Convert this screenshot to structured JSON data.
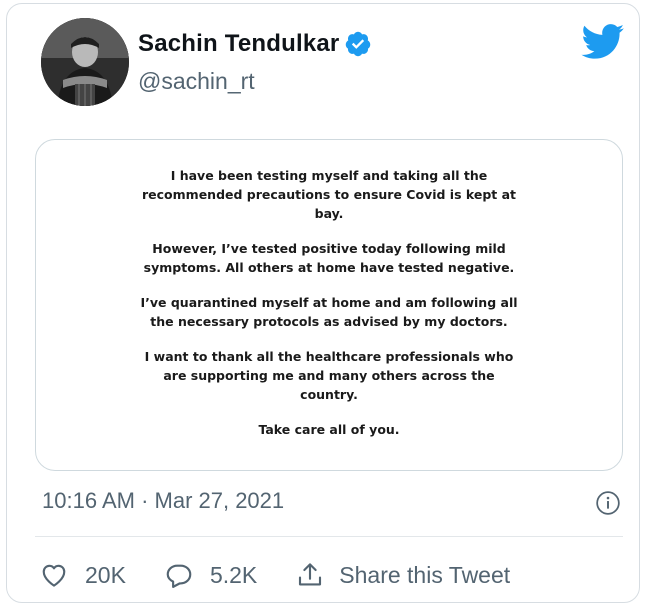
{
  "tweet": {
    "author_name": "Sachin Tendulkar",
    "handle": "@sachin_rt",
    "paragraphs": [
      "I have been testing myself and taking all the recommended precautions to ensure Covid is kept at bay.",
      "However, I’ve tested positive today following mild symptoms. All others at home have tested negative.",
      "I’ve quarantined myself at home and am following all the necessary protocols as advised by my doctors.",
      "I want to thank all the healthcare professionals who are supporting me and many others across the country.",
      "Take care all of you."
    ],
    "timestamp": "10:16 AM · Mar 27, 2021",
    "likes": "20K",
    "replies": "5.2K",
    "share_label": "Share this Tweet"
  },
  "colors": {
    "twitter_blue": "#1d9bf0",
    "secondary_text": "#536471",
    "primary_text": "#0f1419"
  },
  "icons": {
    "logo": "twitter-bird-icon",
    "verified": "verified-badge-icon",
    "info": "info-icon",
    "like": "heart-icon",
    "reply": "reply-bubble-icon",
    "share": "share-icon"
  }
}
